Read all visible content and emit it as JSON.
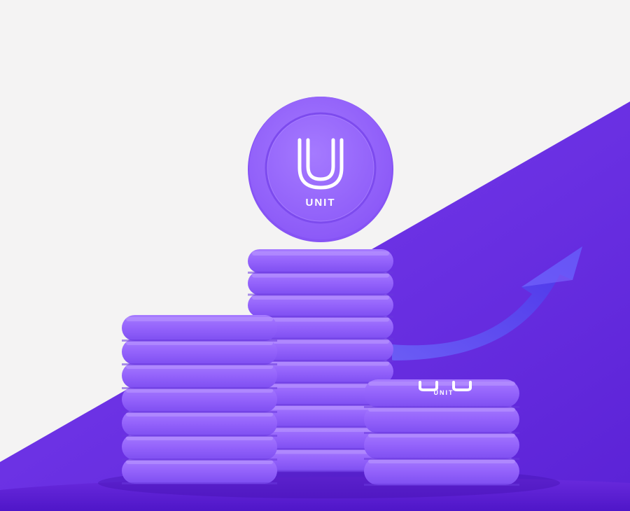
{
  "brand": {
    "name": "UNIT",
    "logo_icon": "unit-u-logo-icon"
  },
  "colors": {
    "background_light": "#f4f3f3",
    "background_purple": "#6a2fe6",
    "coin_face": "#9b6bff",
    "coin_edge": "#7c4cf0",
    "arrow": "#5a3ef0"
  },
  "scene": {
    "description_icons": [
      "coin-stack-left",
      "coin-stack-middle",
      "coin-stack-right",
      "floating-coin",
      "growth-arrow-icon"
    ]
  }
}
